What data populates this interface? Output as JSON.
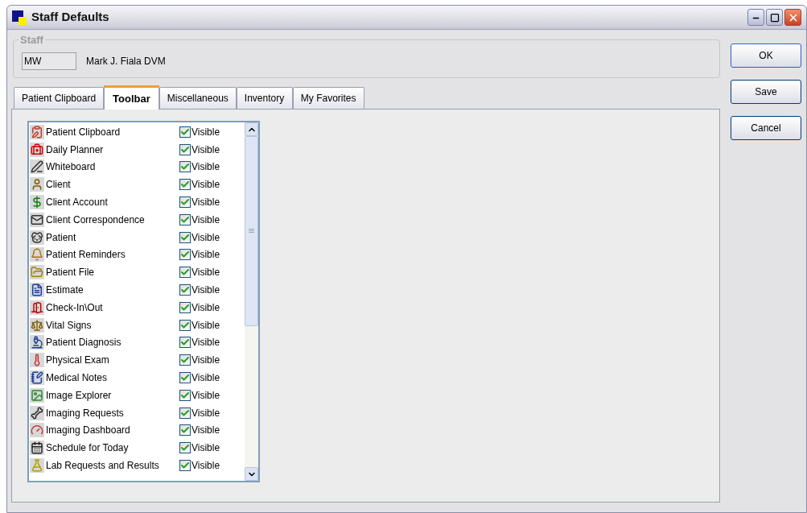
{
  "window": {
    "title": "Staff Defaults"
  },
  "staff": {
    "legend": "Staff",
    "code": "MW",
    "name": "Mark J. Fiala DVM"
  },
  "tabs": [
    {
      "label": "Patient Clipboard",
      "selected": false
    },
    {
      "label": "Toolbar",
      "selected": true
    },
    {
      "label": "Miscellaneous",
      "selected": false
    },
    {
      "label": "Inventory",
      "selected": false
    },
    {
      "label": "My Favorites",
      "selected": false
    }
  ],
  "toolbar_items": [
    {
      "label": "Patient Clipboard",
      "check_label": "Visible",
      "checked": true
    },
    {
      "label": "Daily Planner",
      "check_label": "Visible",
      "checked": true
    },
    {
      "label": "Whiteboard",
      "check_label": "Visible",
      "checked": true
    },
    {
      "label": "Client",
      "check_label": "Visible",
      "checked": true
    },
    {
      "label": "Client Account",
      "check_label": "Visible",
      "checked": true
    },
    {
      "label": "Client Correspondence",
      "check_label": "Visible",
      "checked": true
    },
    {
      "label": "Patient",
      "check_label": "Visible",
      "checked": true
    },
    {
      "label": "Patient Reminders",
      "check_label": "Visible",
      "checked": true
    },
    {
      "label": "Patient File",
      "check_label": "Visible",
      "checked": true
    },
    {
      "label": "Estimate",
      "check_label": "Visible",
      "checked": true
    },
    {
      "label": "Check-In\\Out",
      "check_label": "Visible",
      "checked": true
    },
    {
      "label": "Vital Signs",
      "check_label": "Visible",
      "checked": true
    },
    {
      "label": "Patient Diagnosis",
      "check_label": "Visible",
      "checked": true
    },
    {
      "label": "Physical Exam",
      "check_label": "Visible",
      "checked": true
    },
    {
      "label": "Medical Notes",
      "check_label": "Visible",
      "checked": true
    },
    {
      "label": "Image Explorer",
      "check_label": "Visible",
      "checked": true
    },
    {
      "label": "Imaging Requests",
      "check_label": "Visible",
      "checked": true
    },
    {
      "label": "Imaging Dashboard",
      "check_label": "Visible",
      "checked": true
    },
    {
      "label": "Schedule for Today",
      "check_label": "Visible",
      "checked": true
    },
    {
      "label": "Lab Requests and Results",
      "check_label": "Visible",
      "checked": true
    }
  ],
  "buttons": [
    "OK",
    "Save",
    "Cancel"
  ]
}
